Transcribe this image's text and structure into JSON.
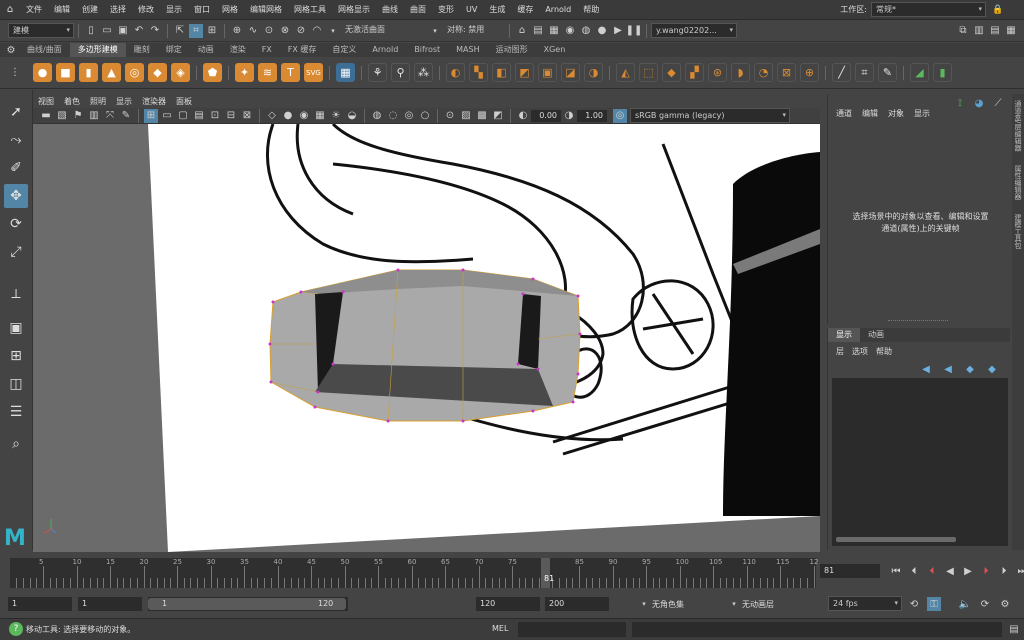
{
  "menubar": {
    "items": [
      "文件",
      "编辑",
      "创建",
      "选择",
      "修改",
      "显示",
      "窗口",
      "网格",
      "编辑网格",
      "网格工具",
      "网格显示",
      "曲线",
      "曲面",
      "变形",
      "UV",
      "生成",
      "缓存",
      "Arnold",
      "帮助"
    ],
    "workspace_label": "工作区:",
    "workspace_value": "常规*"
  },
  "statusline": {
    "mode": "建模",
    "live_surface": "无激活曲面",
    "symmetry": "对称: 禁用",
    "user": "y.wang02202..."
  },
  "shelf_tabs": [
    "曲线/曲面",
    "多边形建模",
    "雕刻",
    "绑定",
    "动画",
    "渲染",
    "FX",
    "FX 缓存",
    "自定义",
    "Arnold",
    "Bifrost",
    "MASH",
    "运动图形",
    "XGen"
  ],
  "shelf_active": "多边形建模",
  "panel_menu": [
    "视图",
    "着色",
    "照明",
    "显示",
    "渲染器",
    "面板"
  ],
  "panel_toolbar": {
    "exposure": "0.00",
    "gamma": "1.00",
    "color_space": "sRGB gamma (legacy)"
  },
  "channel_box": {
    "menu": [
      "通道",
      "编辑",
      "对象",
      "显示"
    ],
    "message_line1": "选择场景中的对象以查看、编辑和设置",
    "message_line2": "通道(属性)上的关键帧"
  },
  "layer_panel": {
    "tabs": [
      "显示",
      "动画"
    ],
    "menu": [
      "层",
      "选项",
      "帮助"
    ]
  },
  "side_tabs": [
    "通道盒/层编辑器",
    "属性编辑器",
    "建模工具包"
  ],
  "time_slider": {
    "ticks": [
      "5",
      "10",
      "15",
      "20",
      "25",
      "30",
      "35",
      "40",
      "45",
      "50",
      "55",
      "60",
      "65",
      "70",
      "75",
      "80",
      "85",
      "90",
      "95",
      "100",
      "105",
      "110",
      "115",
      "12"
    ],
    "current_frame": "81",
    "current_frame_field": "81"
  },
  "range": {
    "start": "1",
    "anim_start": "1",
    "slider_start": "1",
    "slider_end": "120",
    "anim_end": "120",
    "end": "200",
    "char_set": "无角色集",
    "anim_layer": "无动画层",
    "fps": "24 fps"
  },
  "command_line": {
    "help_text": "移动工具: 选择要移动的对象。",
    "lang": "MEL"
  }
}
